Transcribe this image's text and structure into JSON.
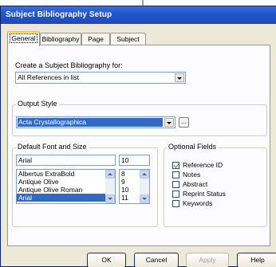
{
  "window": {
    "title": "Subject Bibliography Setup"
  },
  "tabs": [
    {
      "label": "General"
    },
    {
      "label": "Bibliography"
    },
    {
      "label": "Page"
    },
    {
      "label": "Subject"
    }
  ],
  "create": {
    "label": "Create a Subject Bibliography for:",
    "value": "All References in list"
  },
  "output_style": {
    "group_label": "Output Style",
    "value": "Acta Crystallographica",
    "browse_label": "..."
  },
  "font": {
    "group_label": "Default Font and Size",
    "font_value": "Arial",
    "size_value": "10",
    "font_list": [
      "Albertus ExtraBold",
      "Antique Olive",
      "Antique Olive Roman",
      "Arial"
    ],
    "size_list": [
      "8",
      "9",
      "10",
      "11"
    ]
  },
  "optional_fields": {
    "group_label": "Optional Fields",
    "items": [
      {
        "label": "Reference ID",
        "checked": true
      },
      {
        "label": "Notes",
        "checked": false
      },
      {
        "label": "Abstract",
        "checked": false
      },
      {
        "label": "Reprint Status",
        "checked": false
      },
      {
        "label": "Keywords",
        "checked": false
      }
    ]
  },
  "buttons": {
    "ok": "OK",
    "cancel": "Cancel",
    "apply": "Apply",
    "help": "Help"
  },
  "colors": {
    "titlebar": "#2156c9",
    "selection": "#316ac5",
    "dialog_bg": "#ece9d8",
    "panel_bg": "#fcfcfe"
  }
}
